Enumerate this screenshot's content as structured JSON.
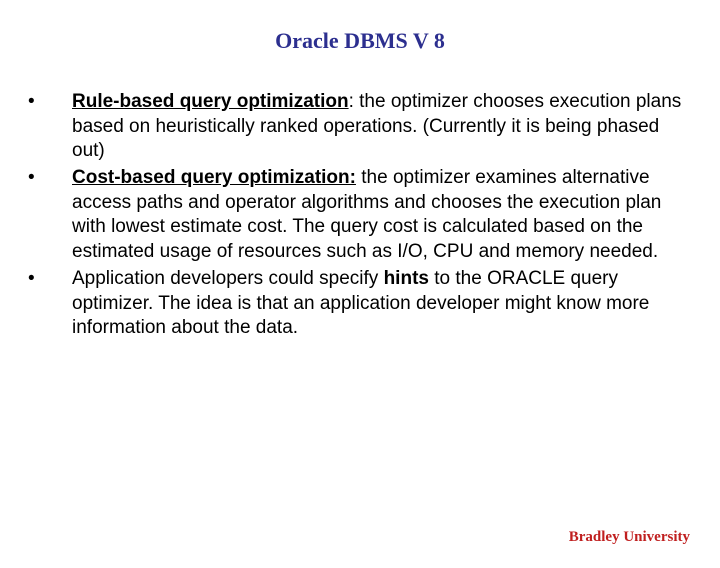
{
  "title": "Oracle DBMS V 8",
  "bullets": [
    {
      "bold_underline": "Rule-based query optimization",
      "rest": ": the optimizer chooses execution plans based on heuristically ranked operations. (Currently it is being phased out)"
    },
    {
      "bold_underline": "Cost-based query optimization:",
      "rest": " the optimizer examines alternative access paths and operator algorithms and chooses the execution plan with lowest estimate cost. The query cost is calculated based on the estimated usage of resources such as I/O, CPU and memory needed."
    },
    {
      "pretext": "Application developers could specify ",
      "bold_word": "hints",
      "rest": " to the ORACLE query optimizer. The idea is that an application developer might know more information about the data."
    }
  ],
  "footer": "Bradley University",
  "bullet_char": "•"
}
